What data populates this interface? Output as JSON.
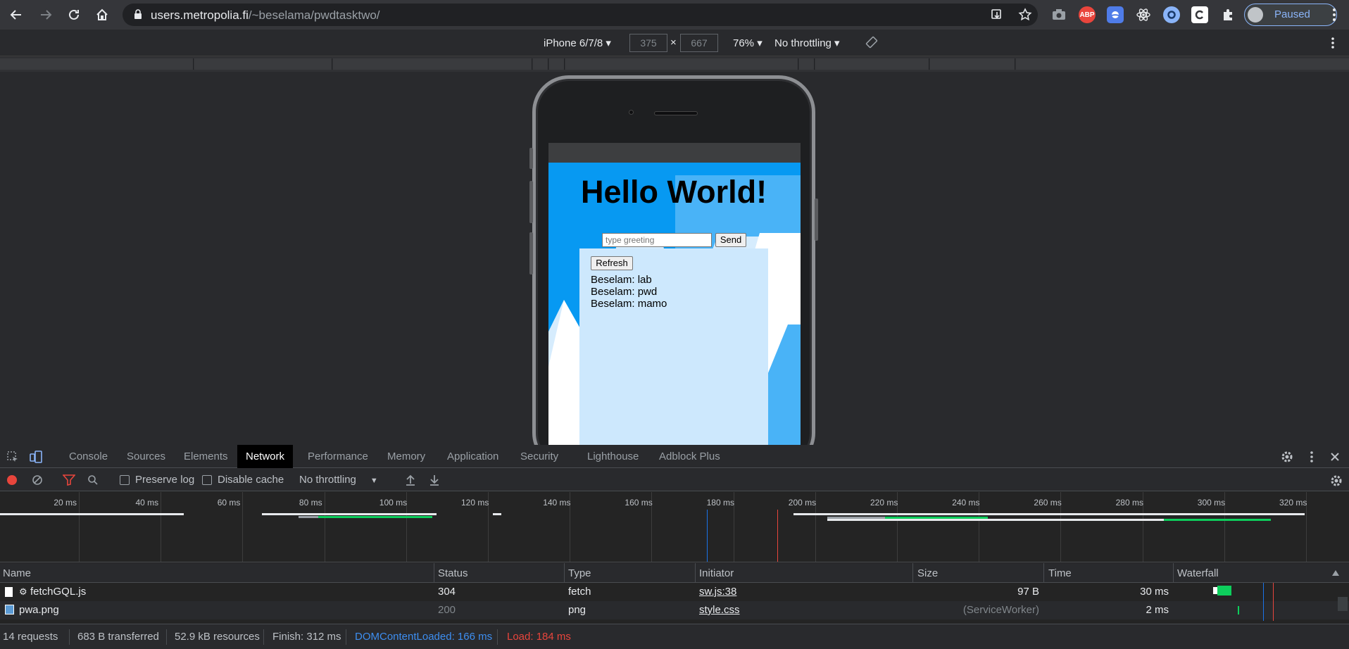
{
  "browser": {
    "url_host": "users.metropolia.fi",
    "url_path": "/~beselama/pwdtasktwo/",
    "profile_label": "Paused",
    "extensions": [
      "camera-icon",
      "abp-icon",
      "shield-ext-icon",
      "react-icon",
      "ring-ext-icon",
      "c-ext-icon",
      "puzzle-icon"
    ],
    "abp_label": "ABP"
  },
  "device_toolbar": {
    "device": "iPhone 6/7/8",
    "width": "375",
    "height": "667",
    "times": "×",
    "zoom": "76%",
    "throttling": "No throttling"
  },
  "page": {
    "heading": "Hello World!",
    "greeting_placeholder": "type greeting",
    "send_label": "Send",
    "refresh_label": "Refresh",
    "messages": [
      {
        "text": "Beselam: lab"
      },
      {
        "text": "Beselam: pwd"
      },
      {
        "text": "Beselam: mamo"
      }
    ],
    "colors": {
      "background": "#0799f2",
      "panel": "#cde8fd"
    }
  },
  "devtools": {
    "tabs": [
      "Console",
      "Sources",
      "Elements",
      "Network",
      "Performance",
      "Memory",
      "Application",
      "Security",
      "Lighthouse",
      "Adblock Plus"
    ],
    "active_tab": "Network",
    "controls": {
      "preserve_log": "Preserve log",
      "disable_cache": "Disable cache",
      "throttling": "No throttling"
    },
    "ticks": [
      "20 ms",
      "40 ms",
      "60 ms",
      "80 ms",
      "100 ms",
      "120 ms",
      "140 ms",
      "160 ms",
      "180 ms",
      "200 ms",
      "220 ms",
      "240 ms",
      "260 ms",
      "280 ms",
      "300 ms",
      "320 ms"
    ],
    "columns": [
      "Name",
      "Status",
      "Type",
      "Initiator",
      "Size",
      "Time",
      "Waterfall"
    ],
    "rows": [
      {
        "name": "fetchGQL.js",
        "status": "304",
        "type": "fetch",
        "initiator": "sw.js:38",
        "size": "97 B",
        "time": "30 ms"
      },
      {
        "name": "pwa.png",
        "status": "200",
        "type": "png",
        "initiator": "style.css",
        "size": "(ServiceWorker)",
        "time": "2 ms"
      }
    ],
    "summary": {
      "requests": "14 requests",
      "transferred": "683 B transferred",
      "resources": "52.9 kB resources",
      "finish": "Finish: 312 ms",
      "dom_content_loaded": "DOMContentLoaded: 166 ms",
      "load": "Load: 184 ms"
    },
    "colors": {
      "dcl": "#1a73e8",
      "load": "#e8453c",
      "download": "#0dce5c"
    }
  }
}
